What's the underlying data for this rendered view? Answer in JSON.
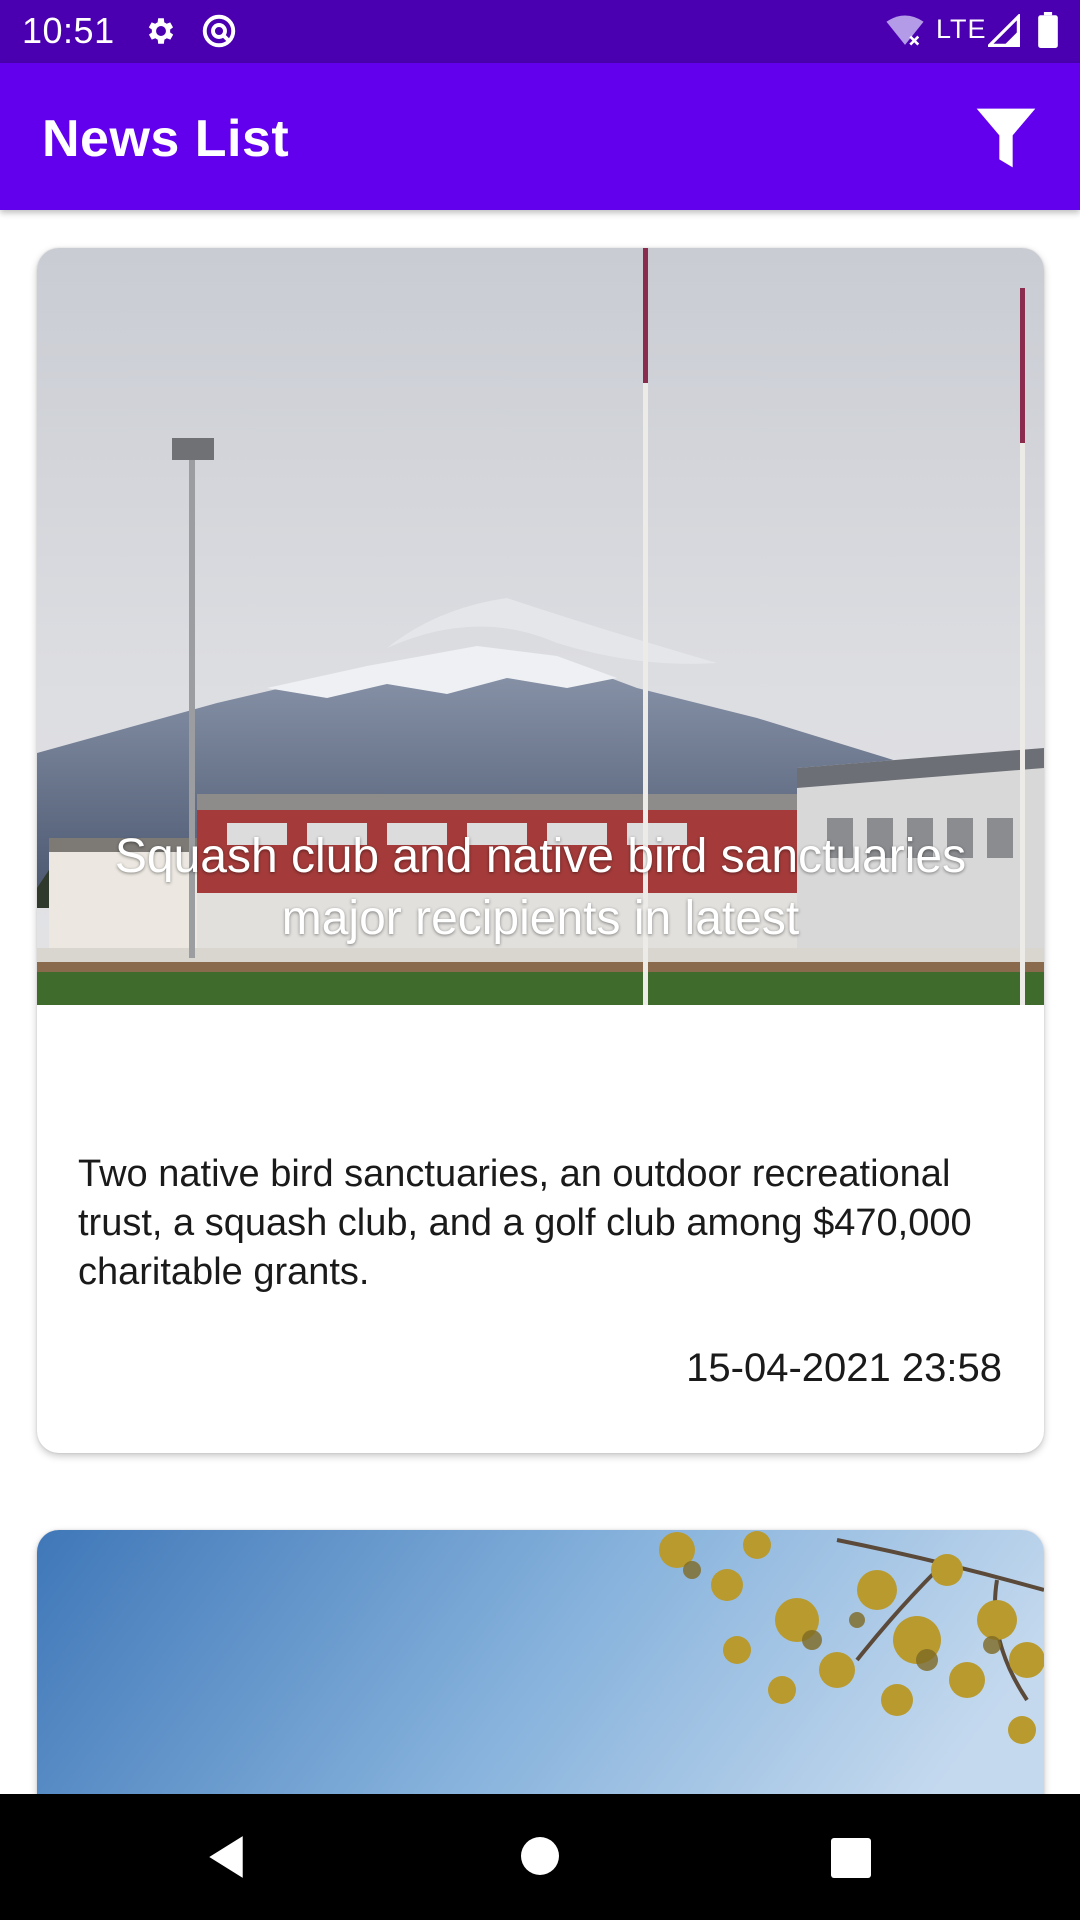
{
  "status_bar": {
    "time": "10:51",
    "network": "LTE",
    "icons": [
      "gear-icon",
      "circle-a-icon",
      "wifi-off-icon",
      "signal-icon",
      "battery-icon"
    ]
  },
  "app_bar": {
    "title": "News List",
    "filter_icon": "filter-icon",
    "background_color": "#6200ee"
  },
  "news": [
    {
      "title": "Squash club and native bird sanctuaries major recipients in latest",
      "description": "Two native bird sanctuaries, an outdoor recreational trust, a squash club, and a golf club among $470,000 charitable grants.",
      "date": "15-04-2021 23:58"
    },
    {
      "title": "",
      "description": "",
      "date": ""
    }
  ],
  "nav_bar": {
    "icons": [
      "back-icon",
      "home-icon",
      "recents-icon"
    ]
  }
}
